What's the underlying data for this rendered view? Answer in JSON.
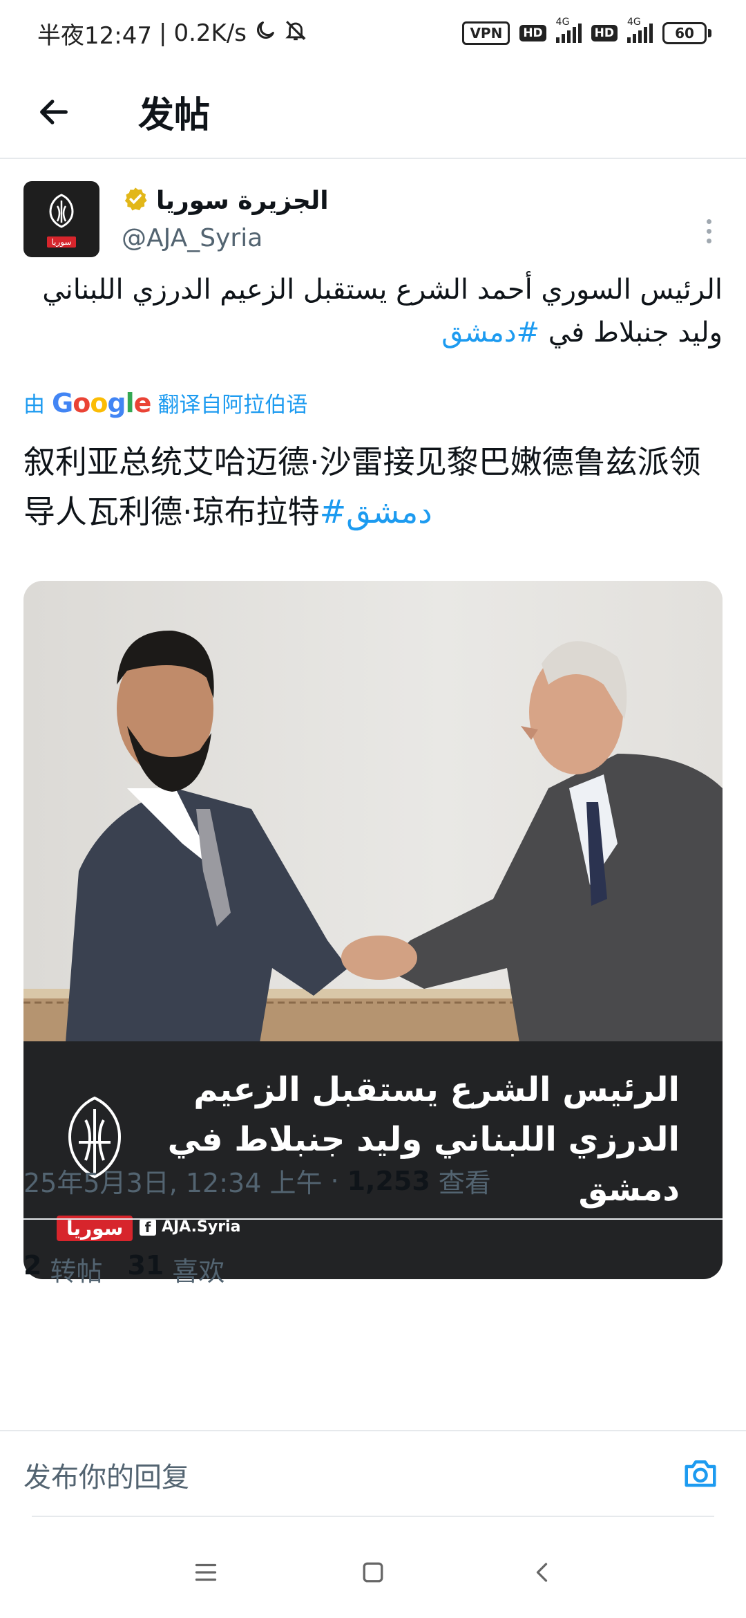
{
  "status_bar": {
    "time": "半夜12:47",
    "speed": "0.2K/s",
    "vpn": "VPN",
    "hd1": "HD",
    "net1": "4G",
    "hd2": "HD",
    "net2": "4G",
    "battery": "60"
  },
  "header": {
    "title": "发帖"
  },
  "tweet": {
    "author_name": "الجزيرة سوريا",
    "handle": "@AJA_Syria",
    "original_text": "الرئيس السوري أحمد الشرع يستقبل الزعيم الدرزي اللبناني وليد جنبلاط في ",
    "original_hashtag": "#دمشق",
    "translated_by_prefix": "由",
    "translated_by_suffix": "翻译自阿拉伯语",
    "google_G": "G",
    "google_o1": "o",
    "google_o2": "o",
    "google_g": "g",
    "google_l": "l",
    "google_e": "e",
    "translated_text": "叙利亚总统艾哈迈德·沙雷接见黎巴嫩德鲁兹派领导人瓦利德·琼布拉特",
    "translated_hashtag": "#دمشق",
    "media": {
      "overlay_headline": "الرئيس الشرع يستقبل الزعيم الدرزي اللبناني وليد جنبلاط في دمشق",
      "brand_tag": "سوريا",
      "fb_handle": "AJA.Syria",
      "avatar_tag": "سوريا"
    },
    "timestamp": "25年5月3日, 12:34 上午",
    "separator": "·",
    "views_count": "1,253",
    "views_label": "查看",
    "reposts_count": "2",
    "reposts_label": "转帖",
    "likes_count": "31",
    "likes_label": "喜欢"
  },
  "reply": {
    "placeholder": "发布你的回复"
  },
  "colors": {
    "accent": "#1d9bf0",
    "text": "#0f1419",
    "muted": "#536471",
    "verified_badge": "#e2b719",
    "brand_red": "#d7252c"
  },
  "icons": {
    "back": "arrow-left-icon",
    "verified": "verified-badge-icon",
    "more": "more-vertical-icon",
    "camera": "camera-icon",
    "nav_menu": "menu-icon",
    "nav_home": "home-square-icon",
    "nav_back": "chevron-left-icon"
  }
}
